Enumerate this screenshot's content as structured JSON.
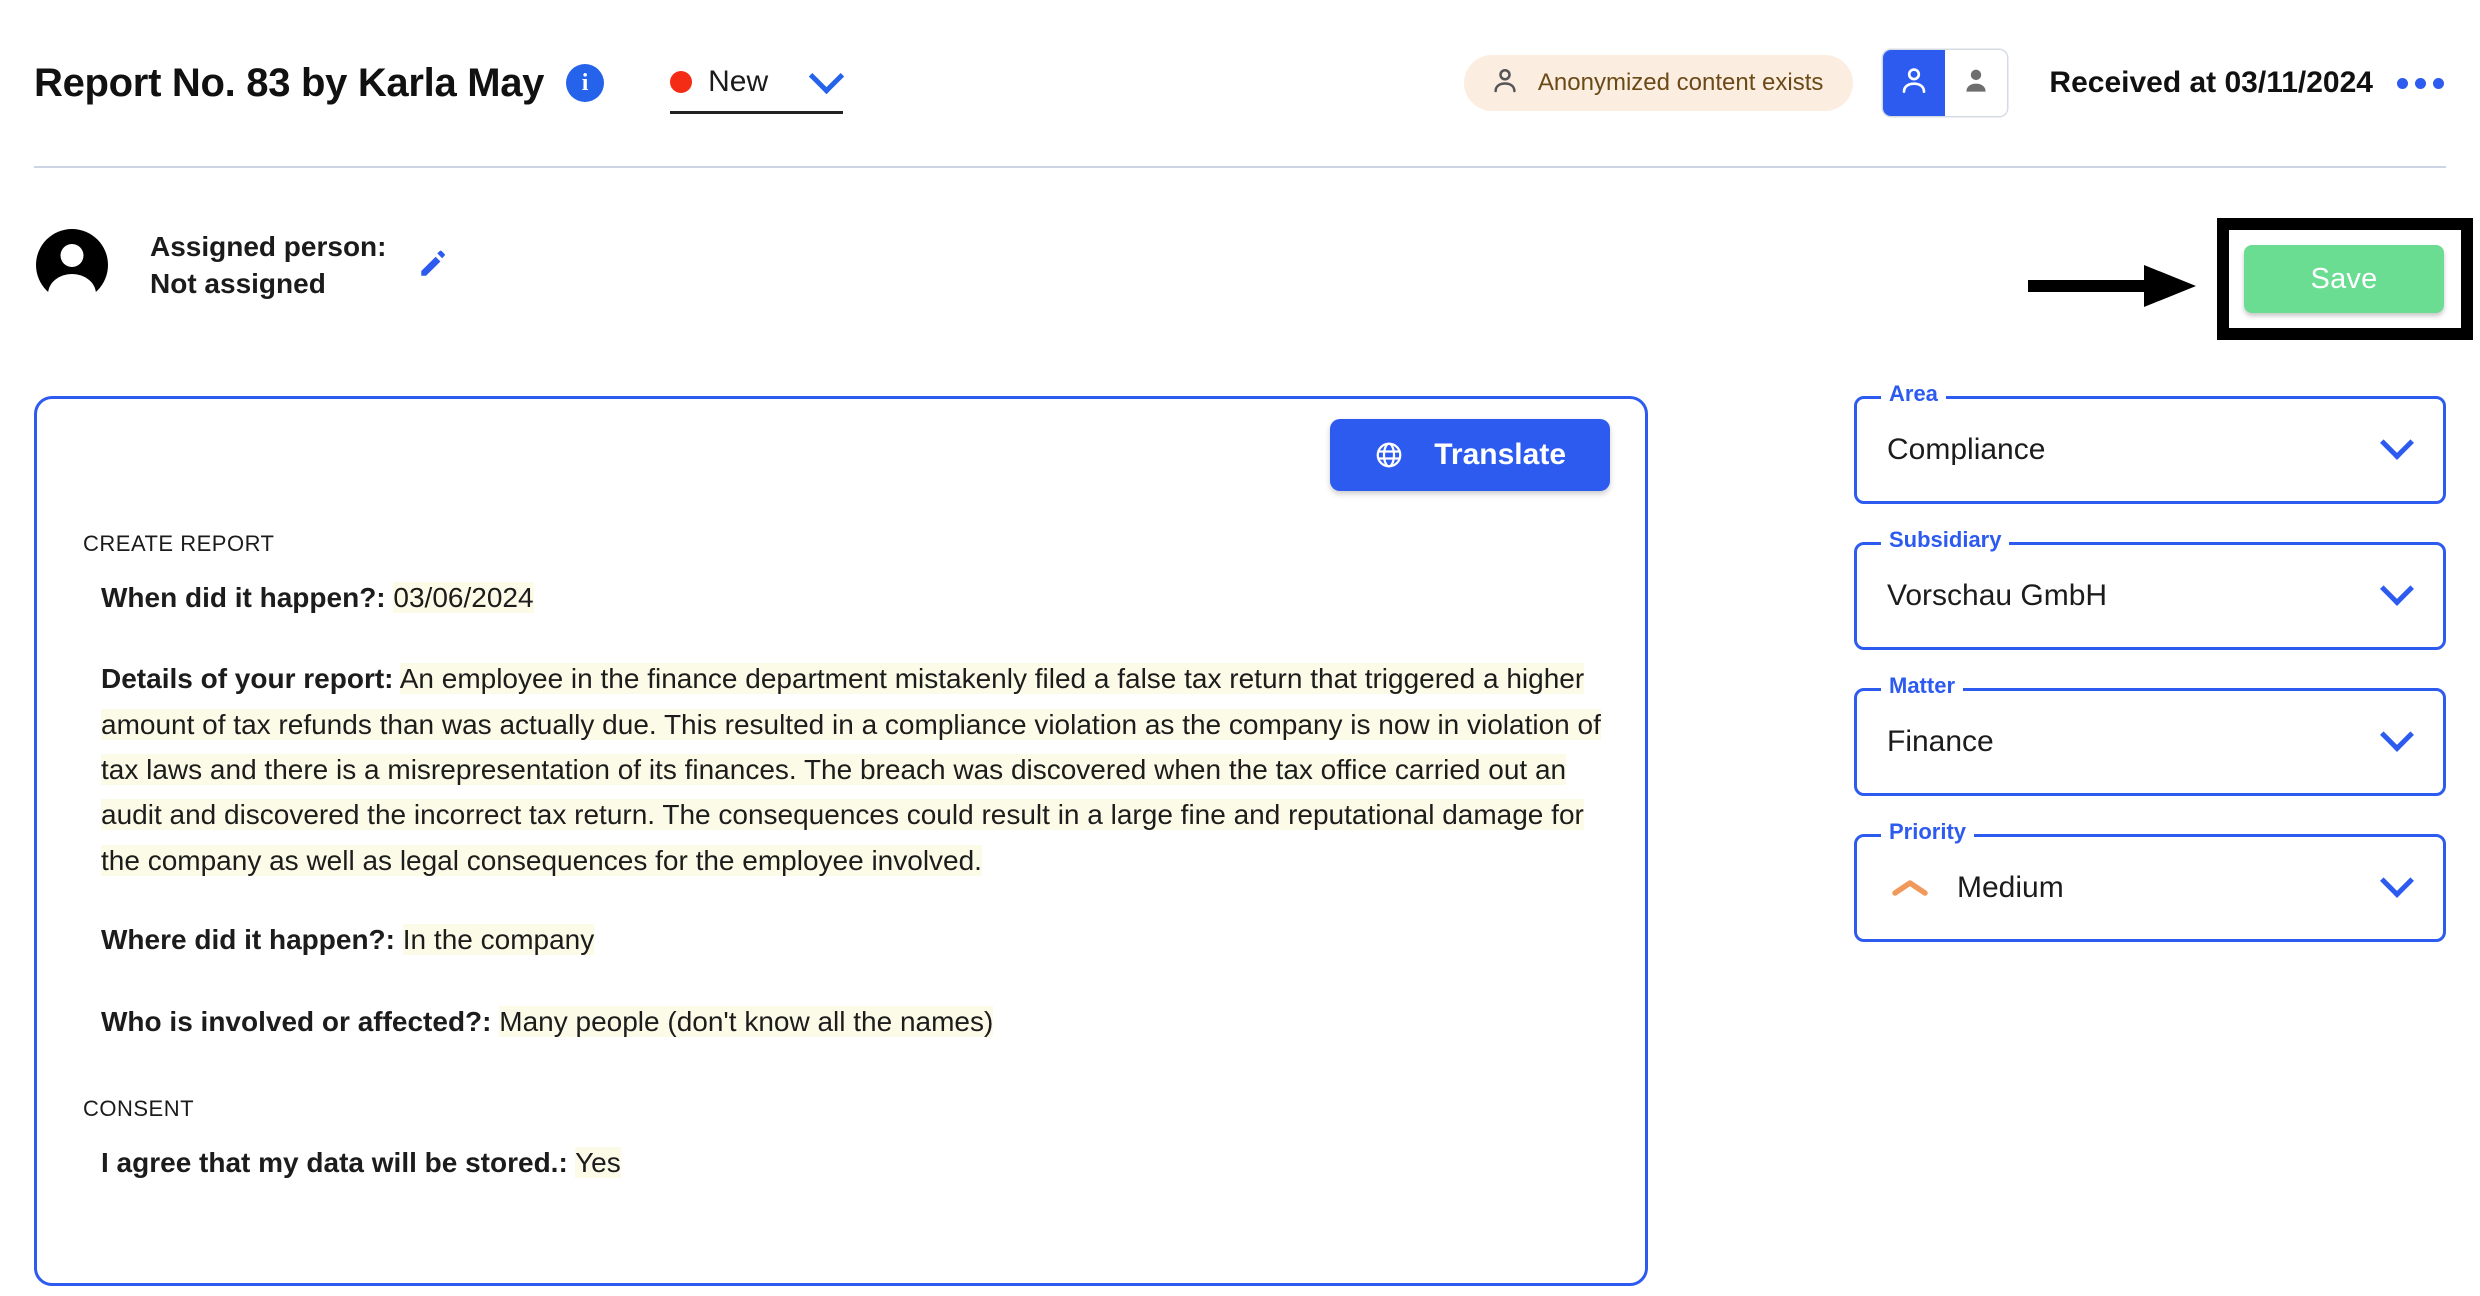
{
  "header": {
    "title": "Report No. 83 by Karla May",
    "info_icon_glyph": "i",
    "status": {
      "label": "New",
      "dot_color": "#F42C16"
    },
    "anonymized_badge": "Anonymized content exists",
    "toggle": {
      "left_icon": "person-outline-icon",
      "right_icon": "person-filled-icon",
      "active": "left"
    },
    "received_label": "Received at 03/11/2024",
    "more_menu_icon": "more-options-icon"
  },
  "assignment": {
    "label": "Assigned person:",
    "value": "Not assigned",
    "edit_icon": "pencil-icon"
  },
  "annotation": {
    "arrow_icon": "arrow-right-annotation",
    "highlight_target": "save-button"
  },
  "actions": {
    "save_label": "Save",
    "save_color": "#6BDD92",
    "translate_label": "Translate",
    "translate_icon": "globe-icon",
    "translate_color": "#2D5BEF"
  },
  "report": {
    "section_one_caption": "CREATE REPORT",
    "section_two_caption": "CONSENT",
    "items": [
      {
        "question": "When did it happen?:",
        "answer": "03/06/2024"
      },
      {
        "question": "Details of your report:",
        "answer": "An employee in the finance department mistakenly filed a false tax return that triggered a higher amount of tax refunds than was actually due. This resulted in a compliance violation as the company is now in violation of tax laws and there is a misrepresentation of its finances. The breach was discovered when the tax office carried out an audit and discovered the incorrect tax return. The consequences could result in a large fine and reputational damage for the company as well as legal consequences for the employee involved."
      },
      {
        "question": "Where did it happen?:",
        "answer": "In the company"
      },
      {
        "question": "Who is involved or affected?:",
        "answer": "Many people (don't know all the names)"
      }
    ],
    "consent_items": [
      {
        "question": "I agree that my data will be stored.:",
        "answer": "Yes"
      }
    ]
  },
  "form": {
    "fields": [
      {
        "label": "Area",
        "value": "Compliance",
        "icon": null
      },
      {
        "label": "Subsidiary",
        "value": "Vorschau GmbH",
        "icon": null
      },
      {
        "label": "Matter",
        "value": "Finance",
        "icon": null
      },
      {
        "label": "Priority",
        "value": "Medium",
        "icon": "priority-medium-chevron-icon",
        "icon_color": "#F0995A"
      }
    ]
  },
  "colors": {
    "accent_blue": "#2D5BEF",
    "highlight_yellow": "#FBFBE8",
    "anon_pill_bg": "#FBEDE0",
    "anon_pill_text": "#6B4A17"
  }
}
